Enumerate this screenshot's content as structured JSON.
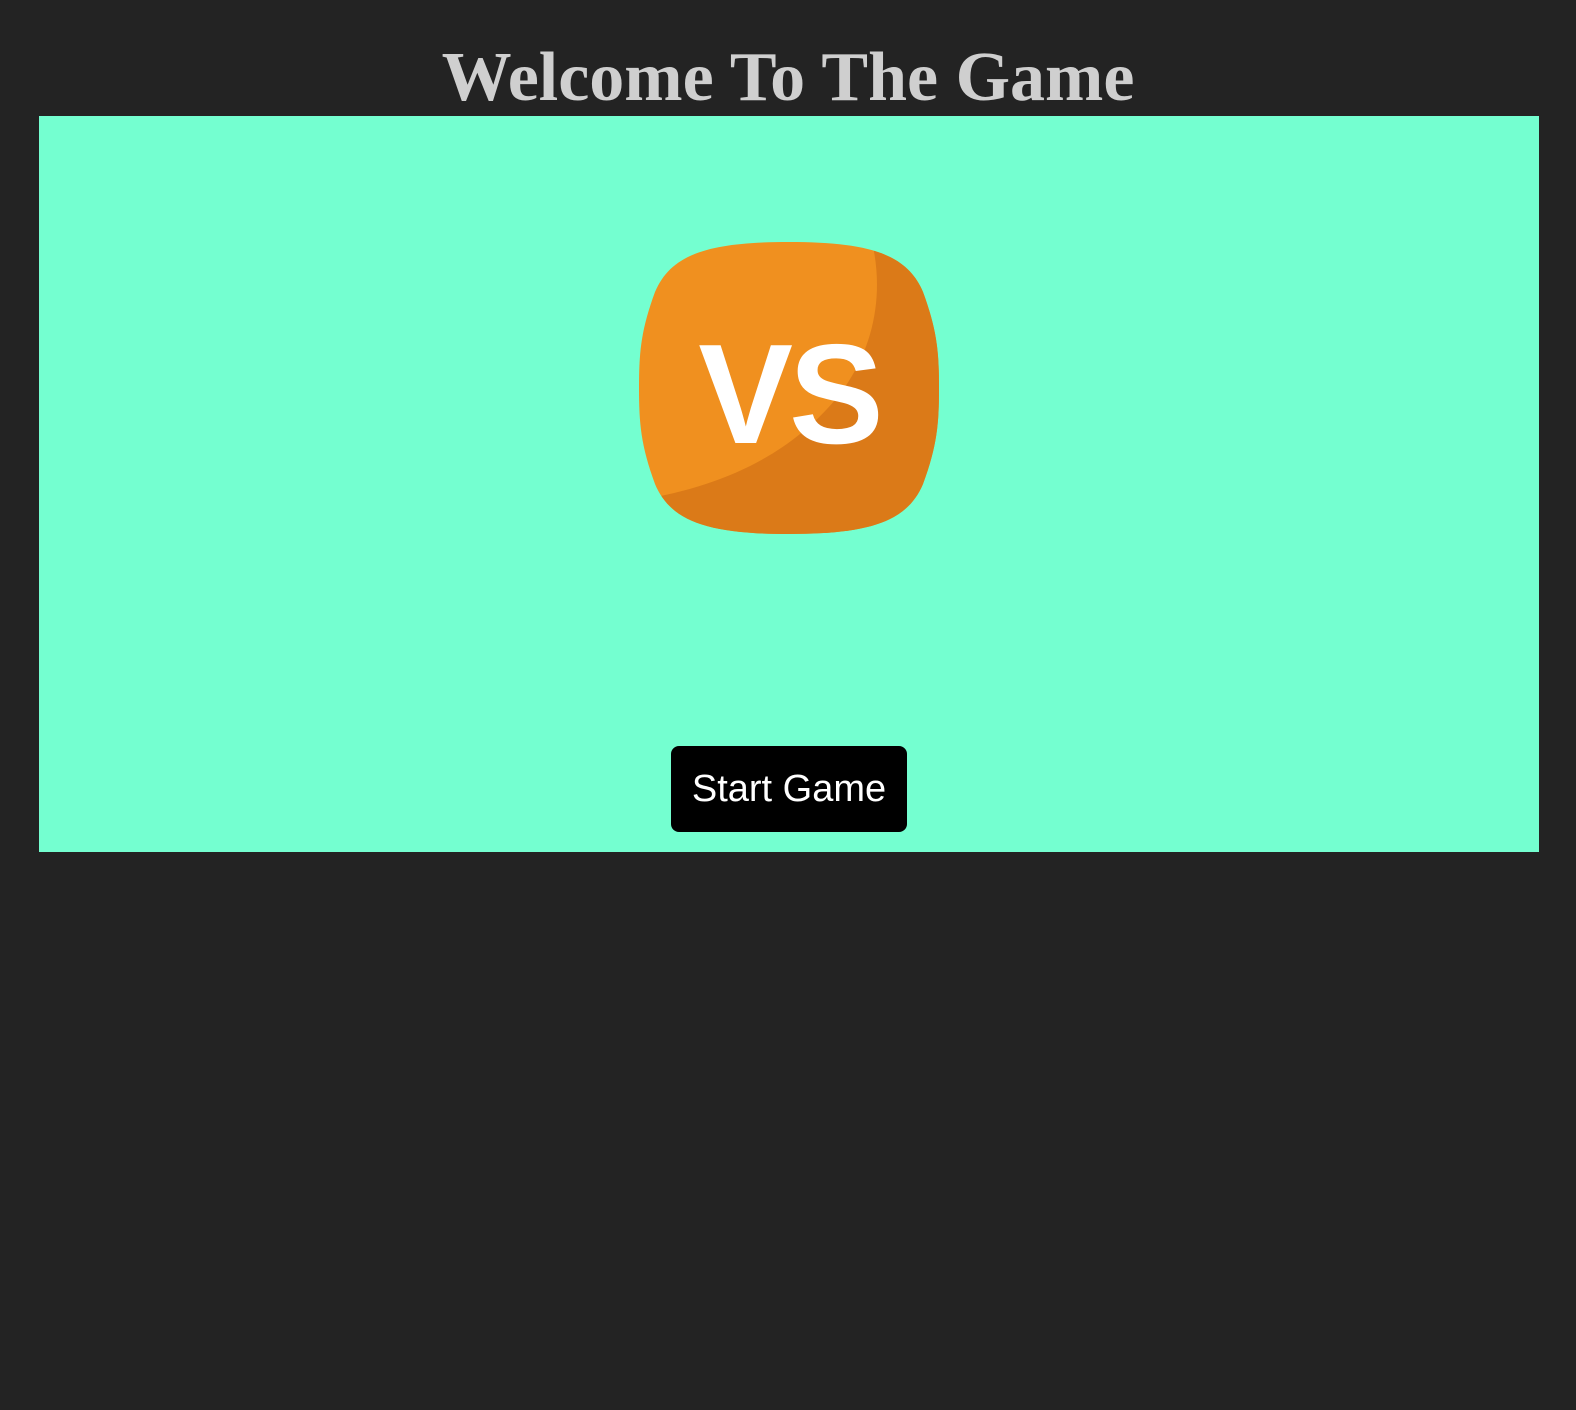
{
  "page": {
    "title": "Welcome To The Game"
  },
  "game_panel": {
    "background_color": "#74ffd0",
    "logo": {
      "icon": "vs-badge-icon",
      "text": "VS",
      "colors": {
        "primary": "#f0901f",
        "shadow": "#db7a18",
        "text": "#ffffff"
      }
    },
    "start_button": {
      "label": "Start Game"
    }
  },
  "colors": {
    "page_background": "#232323",
    "title": "#cfcfcf",
    "button_background": "#000000",
    "button_text": "#ffffff"
  }
}
